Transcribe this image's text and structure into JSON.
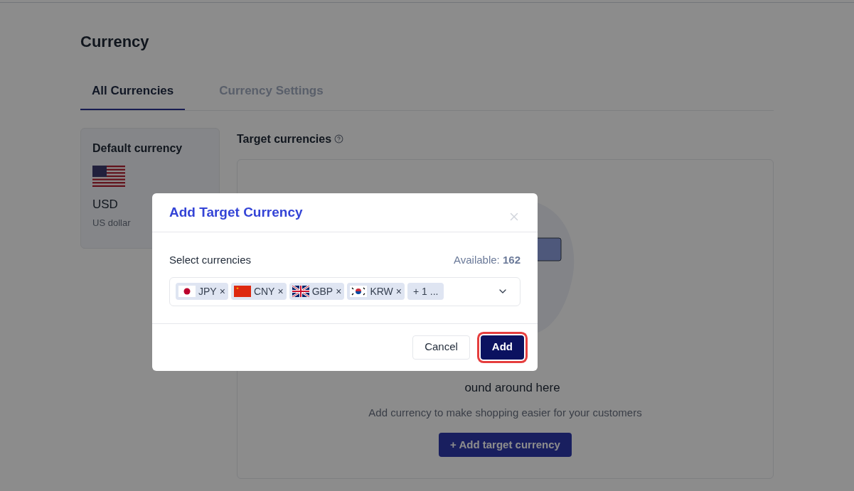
{
  "page": {
    "title": "Currency"
  },
  "tabs": [
    {
      "label": "All Currencies",
      "selected": true
    },
    {
      "label": "Currency Settings",
      "selected": false
    }
  ],
  "default_currency": {
    "heading": "Default currency",
    "code": "USD",
    "name": "US dollar"
  },
  "target_currencies": {
    "heading": "Target currencies",
    "empty_title": "ound around here",
    "empty_text": "Add currency to make shopping easier for your customers",
    "add_button": "+ Add target currency"
  },
  "dialog": {
    "title": "Add Target Currency",
    "field_label": "Select currencies",
    "available_label": "Available:",
    "available_count": "162",
    "tags": [
      {
        "code": "JPY",
        "remove": "×"
      },
      {
        "code": "CNY",
        "remove": "×"
      },
      {
        "code": "GBP",
        "remove": "×"
      },
      {
        "code": "KRW",
        "remove": "×"
      }
    ],
    "more": "+ 1 ...",
    "buttons": [
      {
        "label": "Cancel",
        "kind": "secondary",
        "highlighted": false
      },
      {
        "label": "Add",
        "kind": "primary",
        "highlighted": true
      }
    ]
  }
}
